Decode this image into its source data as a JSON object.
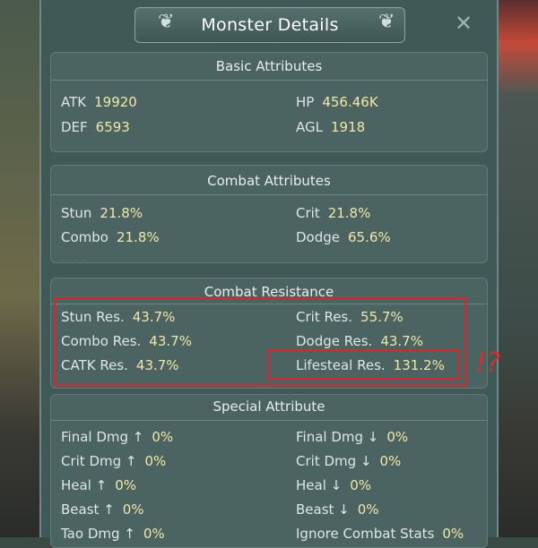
{
  "title": "Monster Details",
  "basic": {
    "title": "Basic Attributes",
    "items": [
      {
        "label": "ATK",
        "value": "19920"
      },
      {
        "label": "HP",
        "value": "456.46K"
      },
      {
        "label": "DEF",
        "value": "6593"
      },
      {
        "label": "AGL",
        "value": "1918"
      }
    ]
  },
  "combat": {
    "title": "Combat Attributes",
    "items": [
      {
        "label": "Stun",
        "value": "21.8%"
      },
      {
        "label": "Crit",
        "value": "21.8%"
      },
      {
        "label": "Combo",
        "value": "21.8%"
      },
      {
        "label": "Dodge",
        "value": "65.6%"
      }
    ]
  },
  "resistance": {
    "title": "Combat Resistance",
    "items": [
      {
        "label": "Stun Res.",
        "value": "43.7%"
      },
      {
        "label": "Crit Res.",
        "value": "55.7%"
      },
      {
        "label": "Combo Res.",
        "value": "43.7%"
      },
      {
        "label": "Dodge Res.",
        "value": "43.7%"
      },
      {
        "label": "CATK Res.",
        "value": "43.7%"
      },
      {
        "label": "Lifesteal Res.",
        "value": "131.2%"
      }
    ]
  },
  "special": {
    "title": "Special Attribute",
    "items": [
      {
        "label": "Final Dmg ↑",
        "value": "0%"
      },
      {
        "label": "Final Dmg ↓",
        "value": "0%"
      },
      {
        "label": "Crit Dmg ↑",
        "value": "0%"
      },
      {
        "label": "Crit Dmg ↓",
        "value": "0%"
      },
      {
        "label": "Heal ↑",
        "value": "0%"
      },
      {
        "label": "Heal ↓",
        "value": "0%"
      },
      {
        "label": "Beast ↑",
        "value": "0%"
      },
      {
        "label": "Beast ↓",
        "value": "0%"
      },
      {
        "label": "Tao Dmg ↑",
        "value": "0%"
      },
      {
        "label": "Ignore Combat Stats",
        "value": "0%"
      }
    ]
  },
  "annotation": "!?",
  "icons": {
    "close": "close-icon",
    "title_ornament_left": "cloud-scroll-icon",
    "title_ornament_right": "cloud-scroll-icon"
  },
  "colors": {
    "value": "#f3e7a6",
    "highlight": "#e0222a"
  }
}
